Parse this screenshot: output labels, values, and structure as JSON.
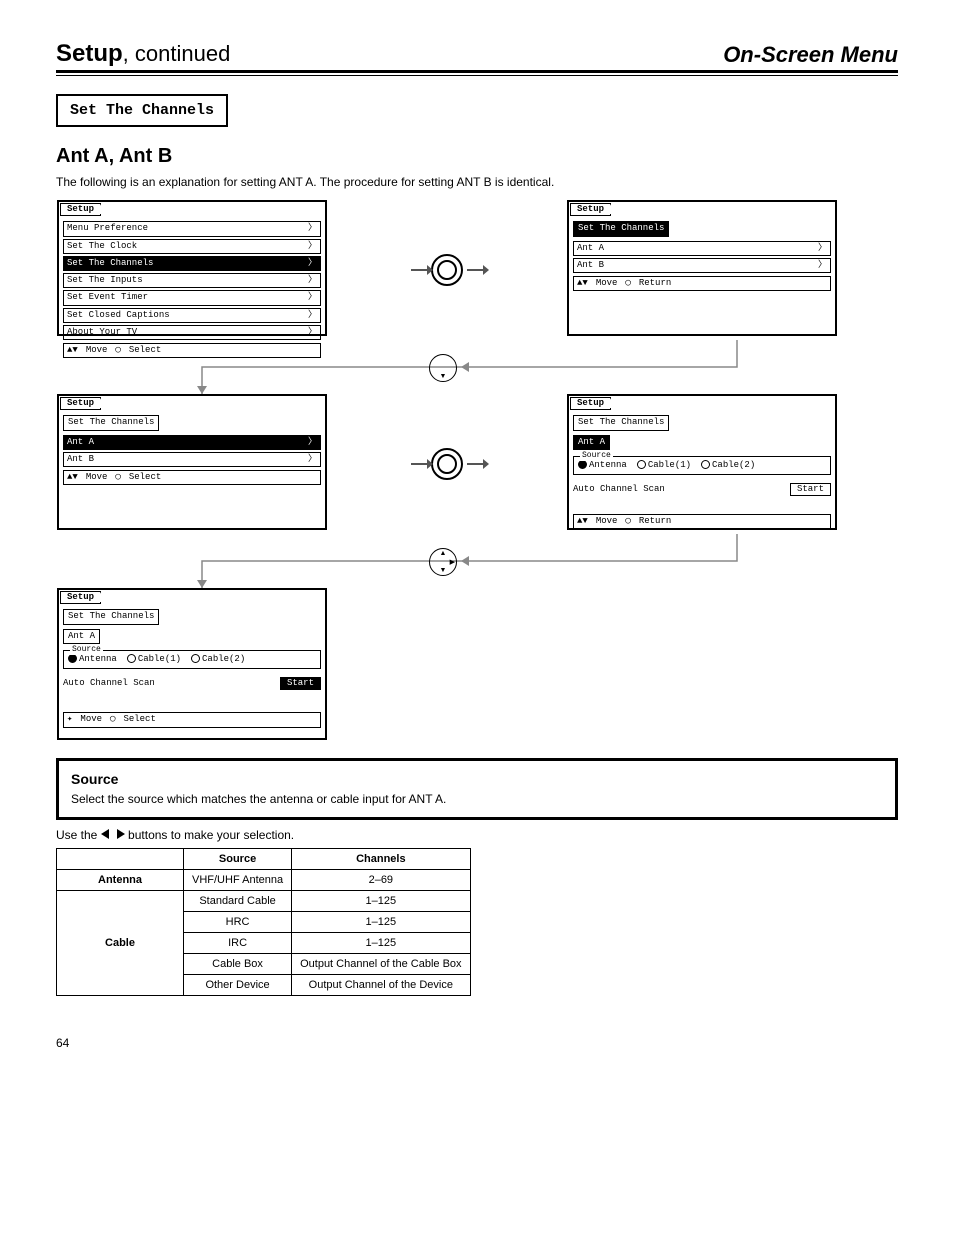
{
  "title": {
    "left": "Setup",
    "right": "On-Screen Menu",
    "cont": ", continued"
  },
  "section_label": "Set The Channels",
  "heading": "Ant A, Ant B",
  "intro": "The following is an explanation for setting ANT A. The procedure for setting ANT B is identical.",
  "osd_common": {
    "tab": "Setup",
    "move": "Move",
    "select": "Select",
    "ret": "Return"
  },
  "osd1": {
    "items": [
      "Menu Preference",
      "Set The Clock",
      "Set The Channels",
      "Set The Inputs",
      "Set Event Timer",
      "Set Closed Captions",
      "About Your TV"
    ],
    "hi": 2
  },
  "osd2": {
    "crumb": "Set The Channels",
    "items": [
      "Ant A",
      "Ant B"
    ]
  },
  "osd3": {
    "crumb": "Set The Channels",
    "items": [
      "Ant A",
      "Ant B"
    ],
    "hi": 0
  },
  "osd4": {
    "crumb": "Set The Channels",
    "sub": "Ant A",
    "source_label": "Source",
    "radios": [
      {
        "label": "Antenna",
        "sel": true
      },
      {
        "label": "Cable(1)",
        "sel": false
      },
      {
        "label": "Cable(2)",
        "sel": false
      }
    ],
    "scan_label": "Auto Channel Scan",
    "start": "Start",
    "start_hi": false
  },
  "osd5": {
    "crumb": "Set The Channels",
    "sub": "Ant A",
    "source_label": "Source",
    "radios": [
      {
        "label": "Antenna",
        "sel": true
      },
      {
        "label": "Cable(1)",
        "sel": false
      },
      {
        "label": "Cable(2)",
        "sel": false
      }
    ],
    "scan_label": "Auto Channel Scan",
    "start": "Start",
    "start_hi": true
  },
  "source_block": {
    "heading": "Source",
    "body": "Select the source which matches the antenna or cable input for ANT A.",
    "sub1": "Use the",
    "sub2": "buttons to make your selection."
  },
  "channel_table": {
    "head": [
      "",
      "Source",
      "Channels"
    ],
    "rows": [
      [
        "Antenna",
        "VHF/UHF Antenna",
        "2–69"
      ],
      [
        "",
        "Standard Cable",
        "1–125"
      ],
      [
        "",
        "HRC",
        "1–125"
      ],
      [
        "Cable",
        "IRC",
        "1–125"
      ],
      [
        "",
        "Cable Box",
        "Output Channel of the Cable Box"
      ],
      [
        "",
        "Other Device",
        "Output Channel of the Device"
      ]
    ],
    "lspan": [
      [
        "Antenna",
        1
      ],
      [
        "Cable",
        5
      ]
    ]
  },
  "page_number": "64",
  "icons": {
    "updown": "▲▼",
    "up": "▲",
    "down": "▼",
    "right": "▶",
    "left": "◀",
    "ring": "○"
  }
}
